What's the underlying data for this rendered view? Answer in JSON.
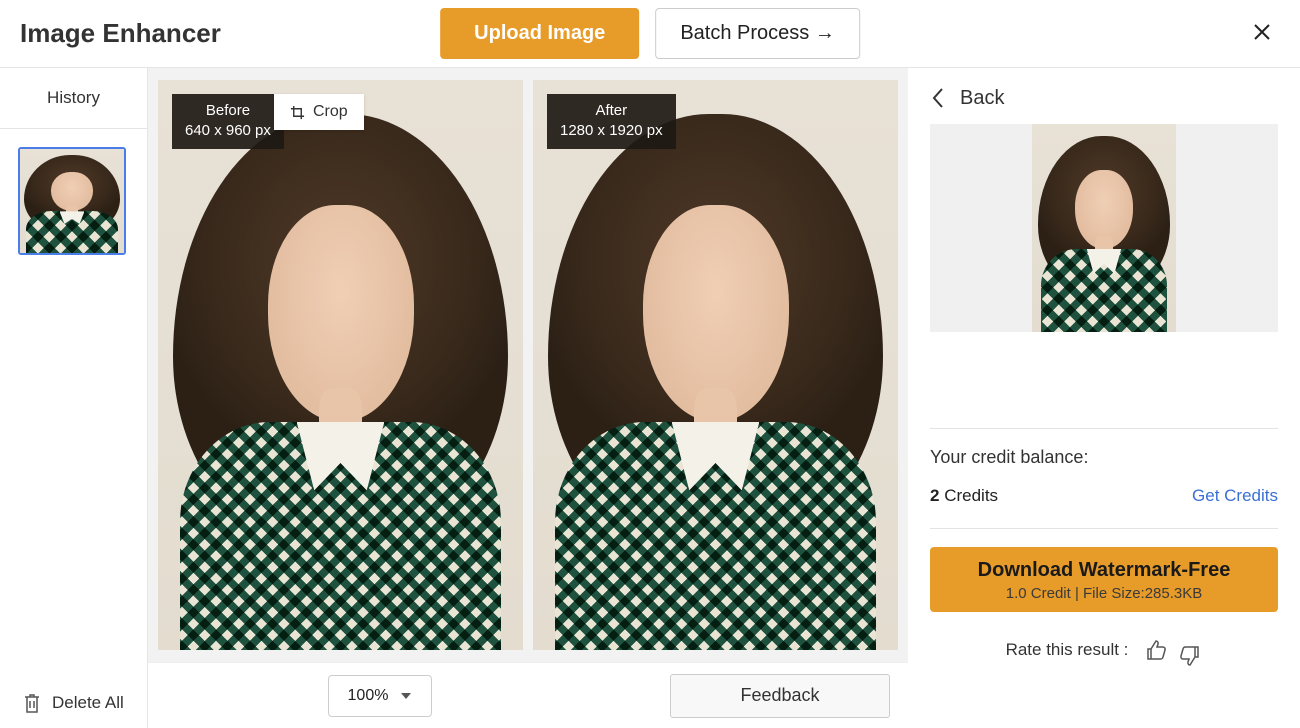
{
  "header": {
    "title": "Image Enhancer",
    "upload_label": "Upload Image",
    "batch_label": "Batch Process →"
  },
  "sidebar": {
    "tab_label": "History",
    "delete_all_label": "Delete All"
  },
  "compare": {
    "before": {
      "title": "Before",
      "dims": "640 x 960 px"
    },
    "after": {
      "title": "After",
      "dims": "1280 x 1920 px"
    },
    "crop_label": "Crop"
  },
  "zoom": {
    "value": "100%"
  },
  "feedback_label": "Feedback",
  "rpanel": {
    "back_label": "Back",
    "credit_balance_label": "Your credit balance:",
    "credit_count": "2",
    "credit_unit": " Credits",
    "get_credits_label": "Get Credits",
    "download": {
      "title": "Download Watermark-Free",
      "subtitle": "1.0 Credit | File Size:285.3KB"
    },
    "rate_label": "Rate this result :"
  }
}
